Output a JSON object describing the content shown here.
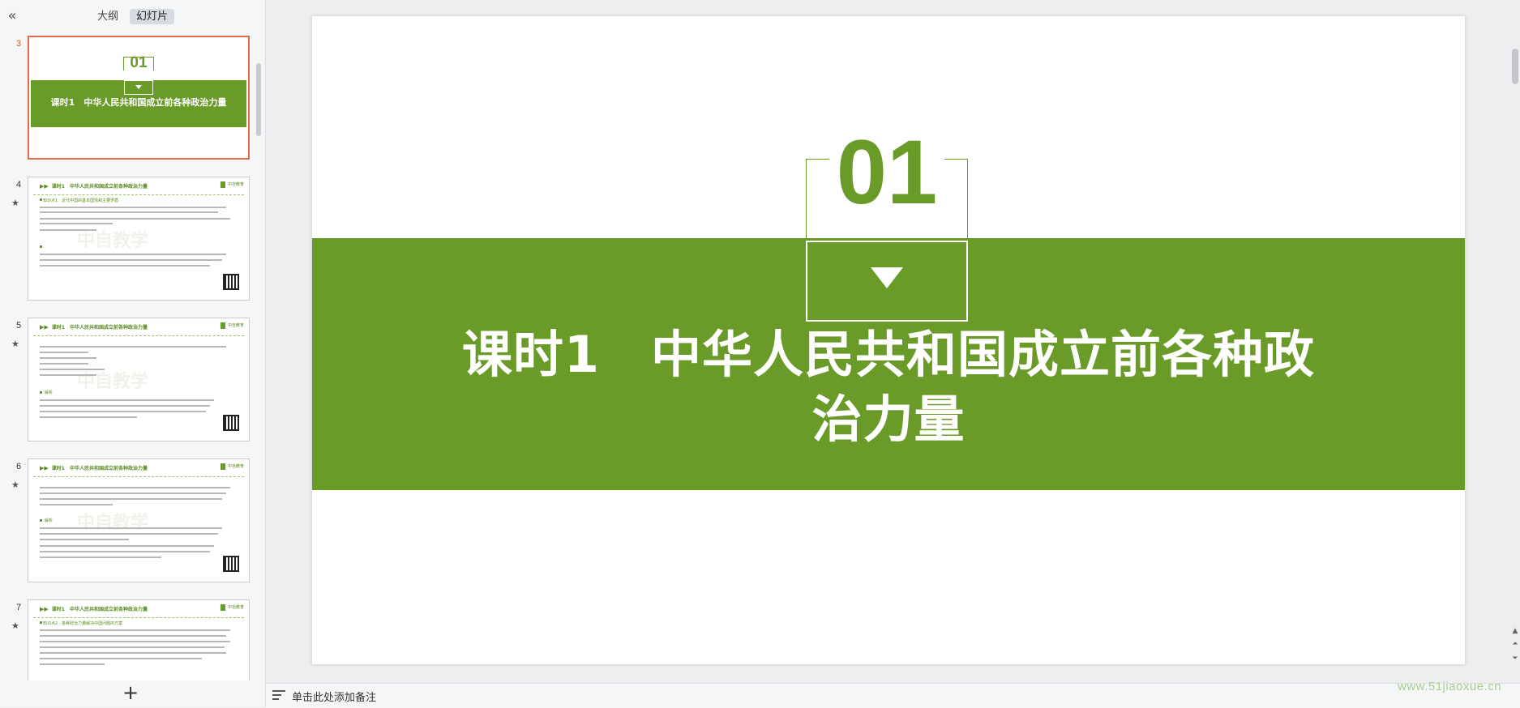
{
  "left_panel": {
    "tabs": [
      {
        "label": "大纲",
        "active": false
      },
      {
        "label": "幻灯片",
        "active": true
      }
    ],
    "add_slide_label": "+"
  },
  "thumbnails": [
    {
      "number": "3",
      "current": true,
      "starred": false,
      "num_text": "01",
      "title": "课时1　中华人民共和国成立前各种政治力量"
    },
    {
      "number": "4",
      "current": false,
      "starred": true,
      "header": "课时1　中华人民共和国成立前各种政治力量",
      "watermark": "中自教学",
      "subhead": "知识点1　近代中国的基本国情和主要矛盾"
    },
    {
      "number": "5",
      "current": false,
      "starred": true,
      "header": "课时1　中华人民共和国成立前各种政治力量",
      "watermark": "中自教学",
      "subhead": "解析"
    },
    {
      "number": "6",
      "current": false,
      "starred": true,
      "header": "课时1　中华人民共和国成立前各种政治力量",
      "watermark": "中自教学",
      "subhead": "解析"
    },
    {
      "number": "7",
      "current": false,
      "starred": true,
      "header": "课时1　中华人民共和国成立前各种政治力量",
      "watermark": "",
      "subhead": "知识点2　各种政治力量解决中国问题的方案"
    }
  ],
  "slide": {
    "number_text": "01",
    "title": "课时1　中华人民共和国成立前各种政治力量",
    "title_line1": "课时1　中华人民共和国成立前各种政",
    "title_line2": "治力量",
    "accent_color": "#6a9a28"
  },
  "notes": {
    "placeholder": "单击此处添加备注"
  },
  "site_watermark": "www.51jiaoxue.cn"
}
